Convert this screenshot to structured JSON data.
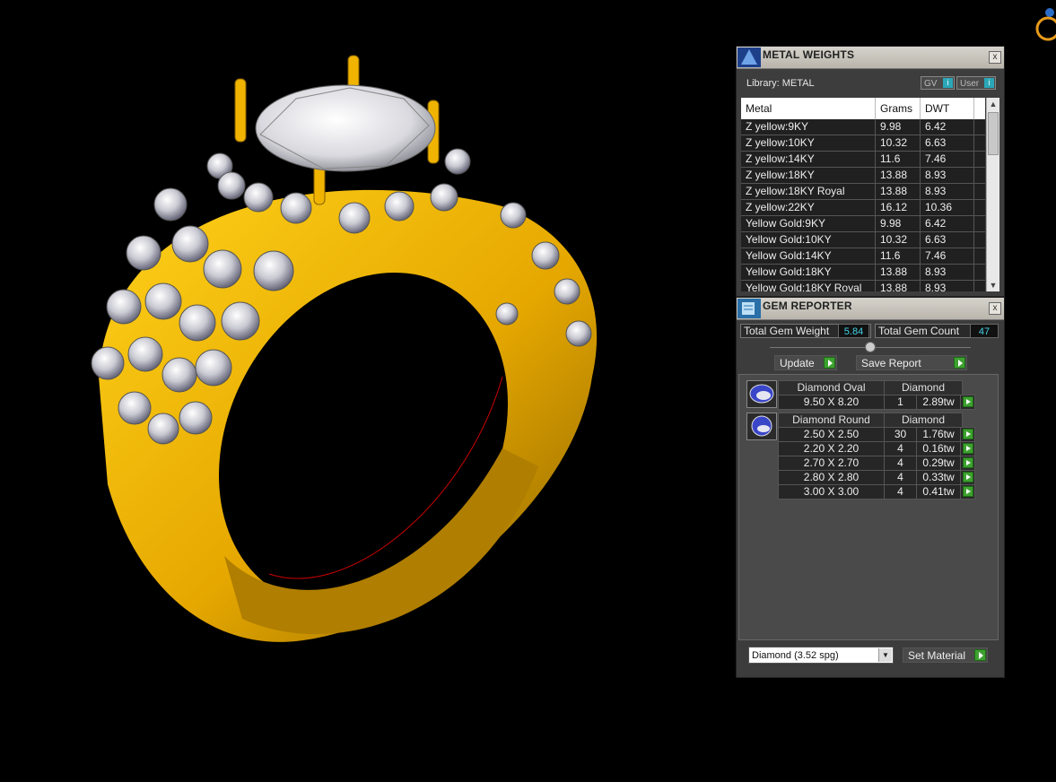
{
  "metal_weights": {
    "title": "METAL WEIGHTS",
    "library_label": "Library: METAL",
    "gv_label": "GV",
    "user_label": "User",
    "info_glyph": "i",
    "close_glyph": "x",
    "columns": [
      "Metal",
      "Grams",
      "DWT"
    ],
    "rows": [
      {
        "metal": "Z yellow:9KY",
        "grams": "9.98",
        "dwt": "6.42"
      },
      {
        "metal": "Z yellow:10KY",
        "grams": "10.32",
        "dwt": "6.63"
      },
      {
        "metal": "Z yellow:14KY",
        "grams": "11.6",
        "dwt": "7.46"
      },
      {
        "metal": "Z yellow:18KY",
        "grams": "13.88",
        "dwt": "8.93"
      },
      {
        "metal": "Z yellow:18KY Royal",
        "grams": "13.88",
        "dwt": "8.93"
      },
      {
        "metal": "Z yellow:22KY",
        "grams": "16.12",
        "dwt": "10.36"
      },
      {
        "metal": "Yellow Gold:9KY",
        "grams": "9.98",
        "dwt": "6.42"
      },
      {
        "metal": "Yellow Gold:10KY",
        "grams": "10.32",
        "dwt": "6.63"
      },
      {
        "metal": "Yellow Gold:14KY",
        "grams": "11.6",
        "dwt": "7.46"
      },
      {
        "metal": "Yellow Gold:18KY",
        "grams": "13.88",
        "dwt": "8.93"
      },
      {
        "metal": "Yellow Gold:18KY Royal",
        "grams": "13.88",
        "dwt": "8.93"
      }
    ]
  },
  "gem_reporter": {
    "title": "GEM REPORTER",
    "close_glyph": "x",
    "total_weight_label": "Total Gem Weight",
    "total_weight_value": "5.84",
    "total_count_label": "Total Gem Count",
    "total_count_value": "47",
    "update_label": "Update",
    "save_report_label": "Save Report",
    "groups": [
      {
        "shape": "Diamond Oval",
        "material": "Diamond",
        "rows": [
          {
            "size": "9.50 X 8.20",
            "count": "1",
            "weight": "2.89tw"
          }
        ]
      },
      {
        "shape": "Diamond Round",
        "material": "Diamond",
        "rows": [
          {
            "size": "2.50 X 2.50",
            "count": "30",
            "weight": "1.76tw"
          },
          {
            "size": "2.20 X 2.20",
            "count": "4",
            "weight": "0.16tw"
          },
          {
            "size": "2.70 X 2.70",
            "count": "4",
            "weight": "0.29tw"
          },
          {
            "size": "2.80 X 2.80",
            "count": "4",
            "weight": "0.33tw"
          },
          {
            "size": "3.00 X 3.00",
            "count": "4",
            "weight": "0.41tw"
          }
        ]
      }
    ],
    "material_select": "Diamond    (3.52 spg)",
    "set_material_label": "Set Material"
  },
  "colors": {
    "gold": "#f0b400",
    "gold_dark": "#8a6200",
    "accent_cyan": "#46d2e6",
    "go_green": "#3da12f"
  }
}
